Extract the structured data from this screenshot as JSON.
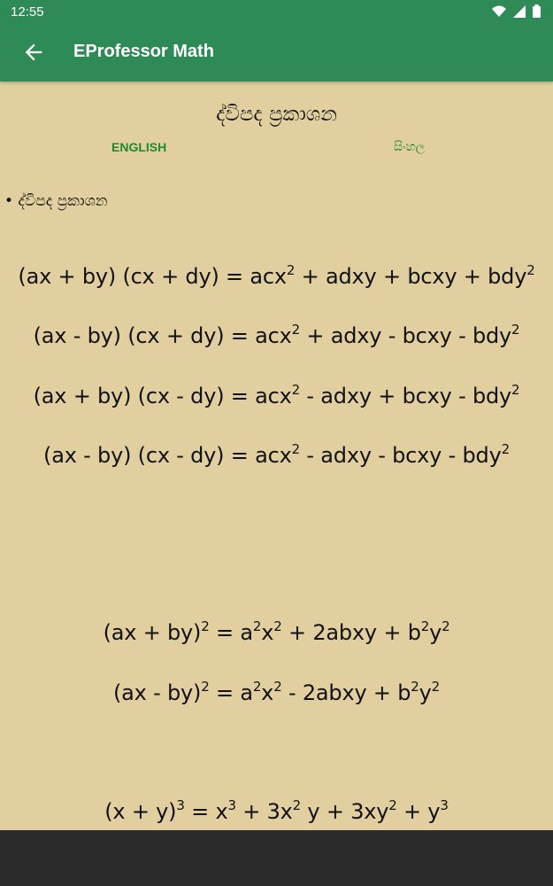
{
  "status": {
    "time": "12:55"
  },
  "app_bar": {
    "title": "EProfessor Math"
  },
  "page": {
    "title": "ද්විපද ප්‍රකාශන",
    "lang_english": "ENGLISH",
    "lang_sinhala": "සිංහල",
    "bullet": "• ද්විපද ප්‍රකාශන"
  },
  "equations": [
    {
      "lhs": "(ax + by) (cx + dy) = acx",
      "p1": "2",
      "m1": " + adxy + bcxy + bdy",
      "p2": "2"
    },
    {
      "lhs": "(ax - by) (cx + dy) = acx",
      "p1": "2",
      "m1": " + adxy - bcxy - bdy",
      "p2": "2"
    },
    {
      "lhs": "(ax + by) (cx - dy) = acx",
      "p1": "2",
      "m1": " - adxy + bcxy - bdy",
      "p2": "2"
    },
    {
      "lhs": "(ax - by) (cx - dy) = acx",
      "p1": "2",
      "m1": " - adxy - bcxy - bdy",
      "p2": "2"
    }
  ],
  "squares": [
    {
      "a": "(ax + by)",
      "a2": "2",
      "b": " = a",
      "b2": "2",
      "c": "x",
      "c2": "2",
      "d": " +  2abxy + b",
      "d2": "2",
      "e": "y",
      "e2": "2"
    },
    {
      "a": "(ax - by)",
      "a2": "2",
      "b": " = a",
      "b2": "2",
      "c": "x",
      "c2": "2",
      "d": " - 2abxy + b",
      "d2": "2",
      "e": "y",
      "e2": "2"
    }
  ],
  "cube": {
    "a": "(x + y)",
    "a3": "3",
    "b": " = x",
    "b3": "3",
    "c": " + 3x",
    "c2": "2",
    "d": " y + 3xy",
    "d2": "2",
    "e": " + y",
    "e3": "3"
  }
}
